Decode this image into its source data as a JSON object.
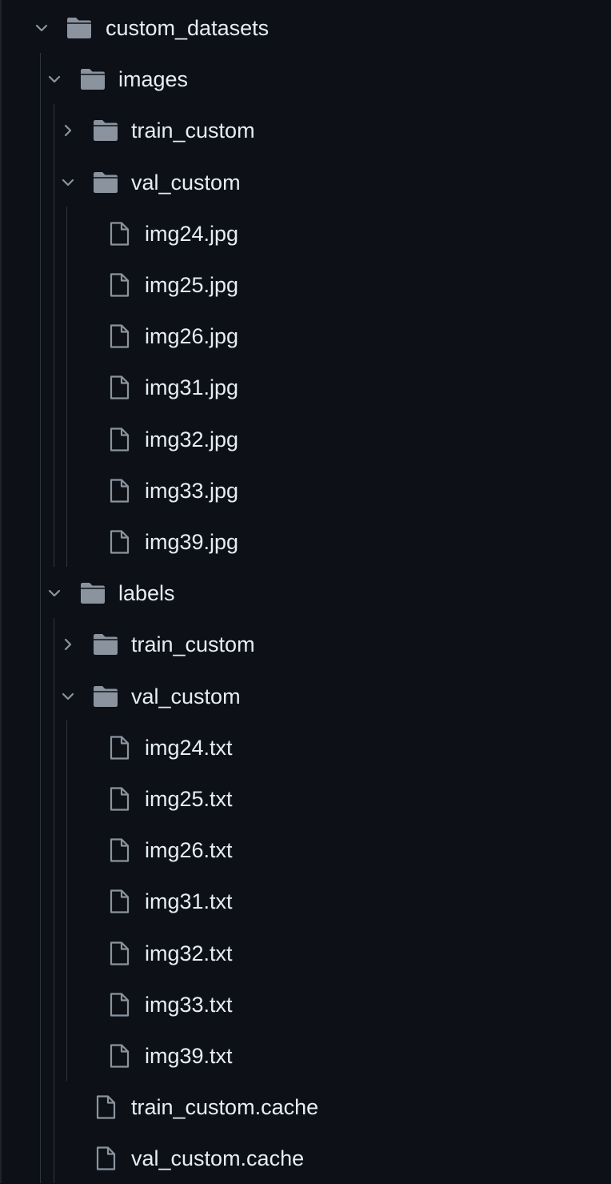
{
  "tree": {
    "root": {
      "label": "custom_datasets",
      "expanded": true,
      "icon": "folder-icon"
    },
    "images": {
      "label": "images",
      "expanded": true,
      "icon": "folder-icon",
      "children": [
        {
          "label": "train_custom",
          "type": "folder",
          "expanded": false
        },
        {
          "label": "val_custom",
          "type": "folder",
          "expanded": true
        }
      ],
      "files": [
        "img24.jpg",
        "img25.jpg",
        "img26.jpg",
        "img31.jpg",
        "img32.jpg",
        "img33.jpg",
        "img39.jpg"
      ]
    },
    "labels": {
      "label": "labels",
      "expanded": true,
      "icon": "folder-icon",
      "children": [
        {
          "label": "train_custom",
          "type": "folder",
          "expanded": false
        },
        {
          "label": "val_custom",
          "type": "folder",
          "expanded": true
        }
      ],
      "files": [
        "img24.txt",
        "img25.txt",
        "img26.txt",
        "img31.txt",
        "img32.txt",
        "img33.txt",
        "img39.txt"
      ],
      "cache_files": [
        "train_custom.cache",
        "val_custom.cache"
      ]
    }
  },
  "colors": {
    "background": "#0d1117",
    "text": "#e6edf3",
    "icon": "#8b949e",
    "guide": "#30363d"
  }
}
